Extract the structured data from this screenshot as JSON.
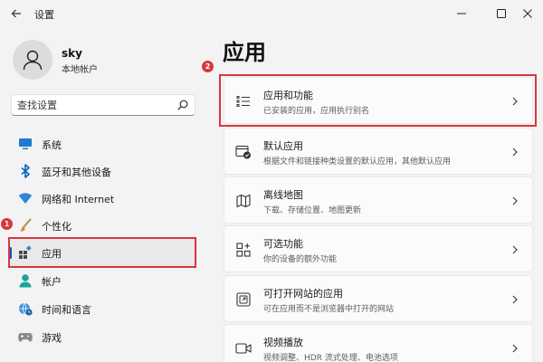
{
  "window": {
    "title": "设置",
    "back_icon": "arrow-left-icon",
    "controls": [
      "minimize-icon",
      "maximize-icon",
      "close-icon"
    ]
  },
  "user": {
    "name": "sky",
    "account_type": "本地帐户",
    "avatar_icon": "person-icon"
  },
  "search": {
    "placeholder": "查找设置",
    "value": "",
    "icon": "search-icon"
  },
  "sidebar": {
    "items": [
      {
        "label": "系统",
        "icon": "monitor-icon",
        "selected": false
      },
      {
        "label": "蓝牙和其他设备",
        "icon": "bluetooth-icon",
        "selected": false
      },
      {
        "label": "网络和 Internet",
        "icon": "wifi-icon",
        "selected": false
      },
      {
        "label": "个性化",
        "icon": "brush-icon",
        "selected": false
      },
      {
        "label": "应用",
        "icon": "apps-icon",
        "selected": true
      },
      {
        "label": "帐户",
        "icon": "account-icon",
        "selected": false
      },
      {
        "label": "时间和语言",
        "icon": "globe-clock-icon",
        "selected": false
      },
      {
        "label": "游戏",
        "icon": "gamepad-icon",
        "selected": false
      }
    ]
  },
  "main": {
    "title": "应用",
    "cards": [
      {
        "title": "应用和功能",
        "subtitle": "已安装的应用，应用执行别名",
        "icon": "list-icon"
      },
      {
        "title": "默认应用",
        "subtitle": "根据文件和链接种类设置的默认应用，其他默认应用",
        "icon": "default-app-icon"
      },
      {
        "title": "离线地图",
        "subtitle": "下载、存储位置、地图更新",
        "icon": "map-icon"
      },
      {
        "title": "可选功能",
        "subtitle": "你的设备的额外功能",
        "icon": "grid-plus-icon"
      },
      {
        "title": "可打开网站的应用",
        "subtitle": "可在应用而不是浏览器中打开的网站",
        "icon": "open-web-icon"
      },
      {
        "title": "视频播放",
        "subtitle": "视频调整、HDR 流式处理、电池选项",
        "icon": "video-icon"
      }
    ]
  },
  "annotations": {
    "badges": [
      "1",
      "2"
    ],
    "color": "#d9363e"
  },
  "colors": {
    "accent": "#005fb8",
    "background": "#f3f3f3",
    "card": "#fbfbfb",
    "annotation": "#d9363e"
  }
}
